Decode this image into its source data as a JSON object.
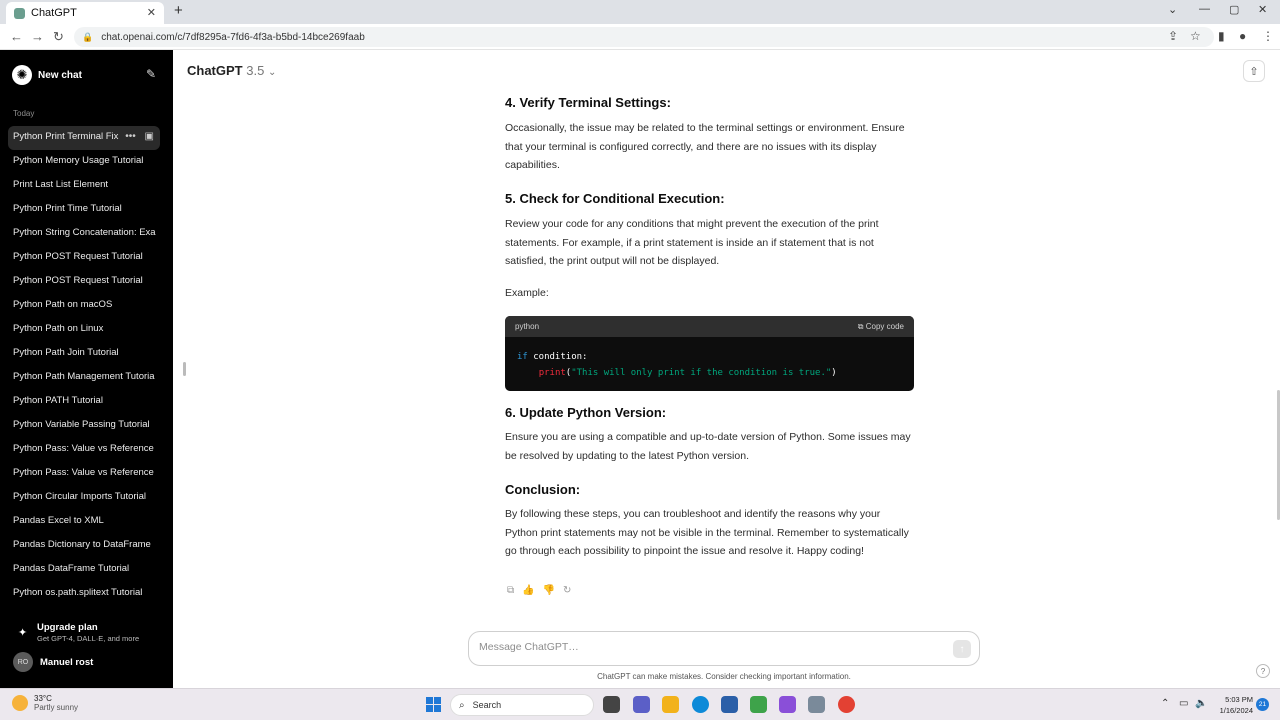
{
  "browser": {
    "tab_title": "ChatGPT",
    "tab_close": "✕",
    "new_tab": "+",
    "url": "chat.openai.com/c/7df8295a-7fd6-4f3a-b5bd-14bce269faab",
    "icons": {
      "back": "←",
      "forward": "→",
      "reload": "↻",
      "lock": "🔒",
      "share": "⇪",
      "star": "☆",
      "sidepanel": "▮",
      "profile": "●",
      "menu": "⋮",
      "chevron": "⌄",
      "minimize": "—",
      "maximize": "▢",
      "close": "✕"
    }
  },
  "sidebar": {
    "new_chat": "New chat",
    "edit_icon": "✎",
    "logo_icon": "✺",
    "section_today": "Today",
    "items": [
      {
        "label": "Python Print Terminal Fix"
      },
      {
        "label": "Python Memory Usage Tutorial"
      },
      {
        "label": "Print Last List Element"
      },
      {
        "label": "Python Print Time Tutorial"
      },
      {
        "label": "Python String Concatenation: Exa"
      },
      {
        "label": "Python POST Request Tutorial"
      },
      {
        "label": "Python POST Request Tutorial"
      },
      {
        "label": "Python Path on macOS"
      },
      {
        "label": "Python Path on Linux"
      },
      {
        "label": "Python Path Join Tutorial"
      },
      {
        "label": "Python Path Management Tutoria"
      },
      {
        "label": "Python PATH Tutorial"
      },
      {
        "label": "Python Variable Passing Tutorial"
      },
      {
        "label": "Python Pass: Value vs Reference"
      },
      {
        "label": "Python Pass: Value vs Reference"
      },
      {
        "label": "Python Circular Imports Tutorial"
      },
      {
        "label": "Pandas Excel to XML"
      },
      {
        "label": "Pandas Dictionary to DataFrame"
      },
      {
        "label": "Pandas DataFrame Tutorial"
      },
      {
        "label": "Python os.path.splitext Tutorial"
      }
    ],
    "active_actions": "•••",
    "archive_icon": "▣",
    "upgrade_title": "Upgrade plan",
    "upgrade_sub": "Get GPT-4, DALL·E, and more",
    "upgrade_icon": "✦",
    "user_initials": "RO",
    "user_name": "Manuel rost"
  },
  "header": {
    "model_name": "ChatGPT",
    "model_version": "3.5",
    "chevron": "⌄",
    "share_icon": "⇧"
  },
  "message": {
    "h4": "4. Verify Terminal Settings:",
    "p4": "Occasionally, the issue may be related to the terminal settings or environment. Ensure that your terminal is configured correctly, and there are no issues with its display capabilities.",
    "h5": "5. Check for Conditional Execution:",
    "p5": "Review your code for any conditions that might prevent the execution of the print statements. For example, if a print statement is inside an if statement that is not satisfied, the print output will not be displayed.",
    "example": "Example:",
    "code_lang": "python",
    "copy_code": "Copy code",
    "copy_icon": "⧉",
    "code_kw": "if",
    "code_line1_rest": " condition:",
    "code_fn": "print",
    "code_str": "\"This will only print if the condition is true.\"",
    "h6": "6. Update Python Version:",
    "p6": "Ensure you are using a compatible and up-to-date version of Python. Some issues may be resolved by updating to the latest Python version.",
    "hc": "Conclusion:",
    "pc": "By following these steps, you can troubleshoot and identify the reasons why your Python print statements may not be visible in the terminal. Remember to systematically go through each possibility to pinpoint the issue and resolve it. Happy coding!"
  },
  "actions": {
    "copy": "⧉",
    "like": "👍",
    "dislike": "👎",
    "regenerate": "↻"
  },
  "composer": {
    "placeholder": "Message ChatGPT…",
    "send_icon": "↑",
    "disclaimer": "ChatGPT can make mistakes. Consider checking important information.",
    "help": "?"
  },
  "taskbar": {
    "temp": "33°C",
    "weather": "Partly sunny",
    "search": "Search",
    "search_icon": "⌕",
    "time": "5:03 PM",
    "date": "1/16/2024",
    "notifications": "21",
    "tray_chevron": "⌃",
    "tray_net": "▭",
    "tray_vol": "🔈",
    "colors": {
      "accent": "#1f78d6"
    }
  }
}
